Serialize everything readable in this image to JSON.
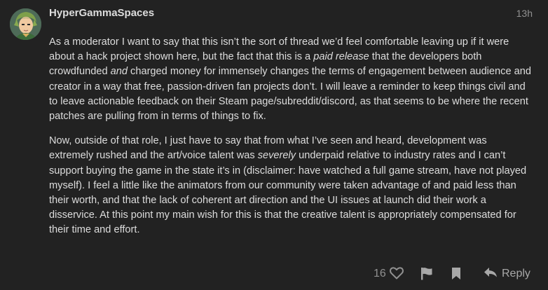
{
  "post": {
    "username": "HyperGammaSpaces",
    "timestamp": "13h",
    "p1": {
      "a": "As a moderator I want to say that this isn’t the sort of thread we’d feel comfortable leaving up if it were about a hack project shown here, but the fact that this is a ",
      "em1": "paid release",
      "b": " that the developers both crowdfunded ",
      "em2": "and",
      "c": " charged money for immensely changes the terms of engagement between audience and creator in a way that free, passion-driven fan projects don’t. I will leave a reminder to keep things civil and to leave actionable feedback on their Steam page/subreddit/discord, as that seems to be where the recent patches are pulling from in terms of things to fix."
    },
    "p2": {
      "a": "Now, outside of that role, I just have to say that from what I’ve seen and heard, development was extremely rushed and the art/voice talent was ",
      "em1": "severely",
      "b": " underpaid relative to industry rates and I can’t support buying the game in the state it’s in (disclaimer: have watched a full game stream, have not played myself). I feel a little like the animators from our community were taken advantage of and paid less than their worth, and that the lack of coherent art direction and the UI issues at launch did their work a disservice. At this point my main wish for this is that the creative talent is appropriately compensated for their time and effort."
    }
  },
  "actions": {
    "like_count": "16",
    "reply_label": "Reply",
    "icons": {
      "like": "heart-outline-icon",
      "flag": "flag-icon",
      "bookmark": "bookmark-icon",
      "reply": "reply-arrow-icon"
    }
  }
}
